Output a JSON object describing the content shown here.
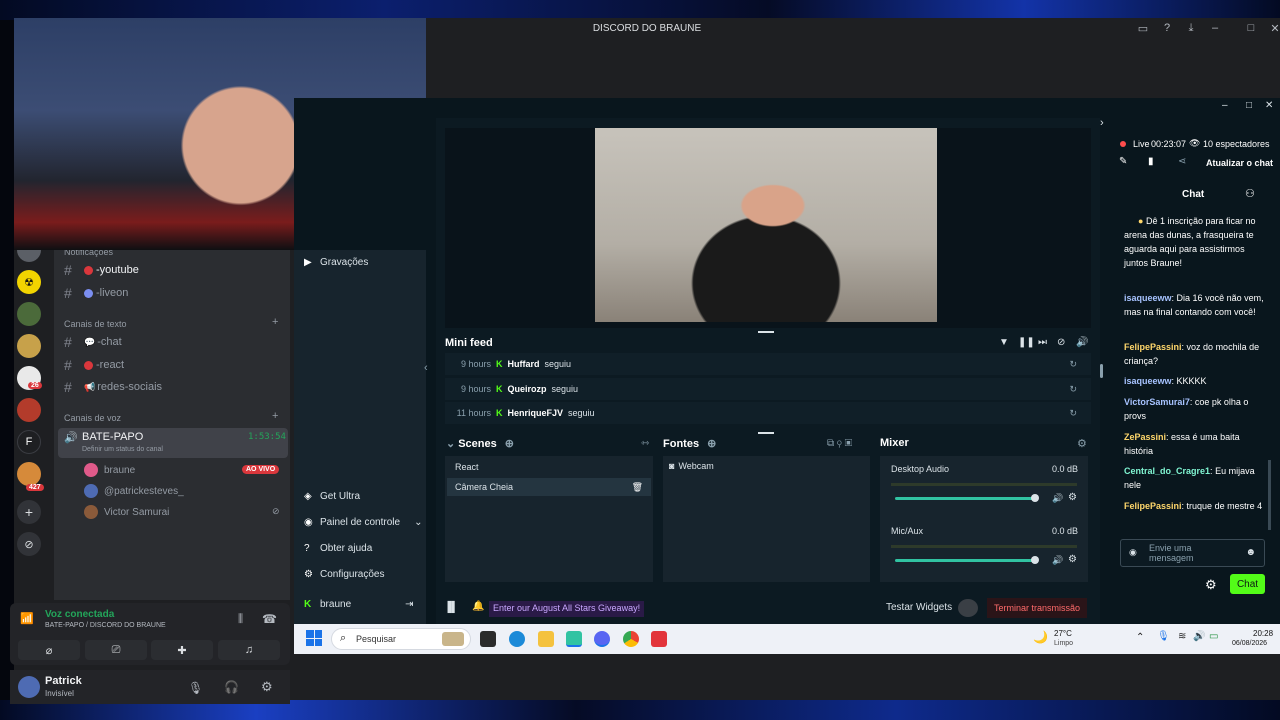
{
  "window": {
    "title": "DISCORD DO BRAUNE"
  },
  "servers": {
    "badge_1": "26",
    "badge_2": "427",
    "letter": "F"
  },
  "channels": {
    "notifications_cat": "Notificações",
    "text_cat": "Canais de texto",
    "voice_cat": "Canais de voz",
    "notif_items": [
      {
        "name": "-youtube",
        "color": "#da373c"
      },
      {
        "name": "-liveon",
        "color": "#7b8ef0"
      }
    ],
    "text_items": [
      {
        "name": "-chat",
        "emoji": "💬"
      },
      {
        "name": "-react",
        "color": "#da373c"
      },
      {
        "name": "redes-sociais",
        "emoji": "📢"
      }
    ],
    "voice_channel": {
      "name": "BATE-PAPO",
      "timer": "1:53:54",
      "status": "Definir um status do canal"
    },
    "voice_users": [
      {
        "name": "braune",
        "live": "AO VIVO"
      },
      {
        "name": "@patrickesteves_"
      },
      {
        "name": "Victor Samurai"
      }
    ]
  },
  "voice_panel": {
    "status": "Voz conectada",
    "location": "BATE-PAPO / DISCORD DO BRAUNE"
  },
  "user": {
    "name": "Patrick",
    "status": "Invisível"
  },
  "streamlabs": {
    "nav": {
      "recordings": "Gravações",
      "get_ultra": "Get Ultra",
      "control_panel": "Painel de controle",
      "help": "Obter ajuda",
      "settings": "Configurações",
      "account": "braune"
    },
    "mini_feed": {
      "title": "Mini feed",
      "rows": [
        {
          "time": "9 hours",
          "user": "Huffard",
          "action": "seguiu"
        },
        {
          "time": "9 hours",
          "user": "Queirozp",
          "action": "seguiu"
        },
        {
          "time": "11 hours",
          "user": "HenriqueFJV",
          "action": "seguiu"
        }
      ]
    },
    "scenes": {
      "title": "Scenes",
      "items": [
        "React",
        "Câmera Cheia"
      ]
    },
    "sources": {
      "title": "Fontes",
      "items": [
        "Webcam"
      ]
    },
    "mixer": {
      "title": "Mixer",
      "channels": [
        {
          "name": "Desktop Audio",
          "db": "0.0 dB",
          "level": 1.0
        },
        {
          "name": "Mic/Aux",
          "db": "0.0 dB",
          "level": 1.0
        }
      ]
    },
    "footer": {
      "giveaway": "Enter our August All Stars Giveaway!",
      "test_widgets": "Testar Widgets",
      "end_stream": "Terminar transmissão"
    },
    "stream_status": {
      "live_label": "Live",
      "uptime": "00:23:07",
      "viewers": "10 espectadores",
      "refresh": "Atualizar o chat"
    }
  },
  "chat": {
    "title": "Chat",
    "pinned": "Dê 1 inscrição para ficar no arena das dunas, a frasqueira te aguarda aqui para assistirmos juntos Braune!",
    "messages": [
      {
        "user": "isaqueeww",
        "text": "Dia 16 você não vem, mas na final contando com você!"
      },
      {
        "user": "FelipePassini",
        "text": "voz do mochila de criança?"
      },
      {
        "user": "isaqueeww",
        "text": "KKKKK"
      },
      {
        "user": "VictorSamurai7",
        "text": "coe pk olha o provs"
      },
      {
        "user": "ZePassini",
        "text": "essa é uma baita história"
      },
      {
        "user": "Central_do_Cragre1",
        "text": "Eu mijava nele"
      },
      {
        "user": "FelipePassini",
        "text": "truque de mestre 4"
      }
    ],
    "input_placeholder": "Envie uma mensagem",
    "send_label": "Chat"
  },
  "taskbar": {
    "search": "Pesquisar",
    "weather_temp": "27°C",
    "weather_desc": "Limpo",
    "time": "20:28",
    "date": "06/08/2026"
  },
  "colors": {
    "accent_green": "#53fc18",
    "streamlabs_teal": "#31c3a2",
    "live_red": "#da373c"
  }
}
